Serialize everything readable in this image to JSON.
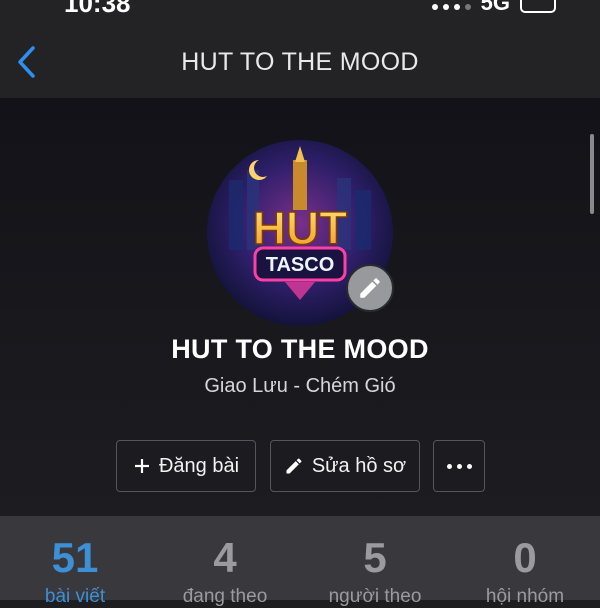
{
  "status": {
    "time": "10:38",
    "network": "5G"
  },
  "nav": {
    "title": "HUT TO THE MOOD",
    "back_icon": "chevron-left-icon",
    "accent": "#2f8ff0"
  },
  "profile": {
    "name": "HUT TO THE MOOD",
    "subtitle": "Giao Lưu - Chém Gió",
    "avatar_text_main": "HUT",
    "avatar_text_sign": "TASCO"
  },
  "actions": {
    "post_label": "Đăng bài",
    "edit_label": "Sửa hồ sơ",
    "post_icon": "plus-icon",
    "edit_icon": "pencil-icon",
    "more_icon": "ellipsis-icon"
  },
  "stats": [
    {
      "value": "51",
      "label": "bài viết",
      "active": true
    },
    {
      "value": "4",
      "label": "đang theo",
      "active": false
    },
    {
      "value": "5",
      "label": "người theo",
      "active": false
    },
    {
      "value": "0",
      "label": "hội nhóm",
      "active": false
    }
  ]
}
